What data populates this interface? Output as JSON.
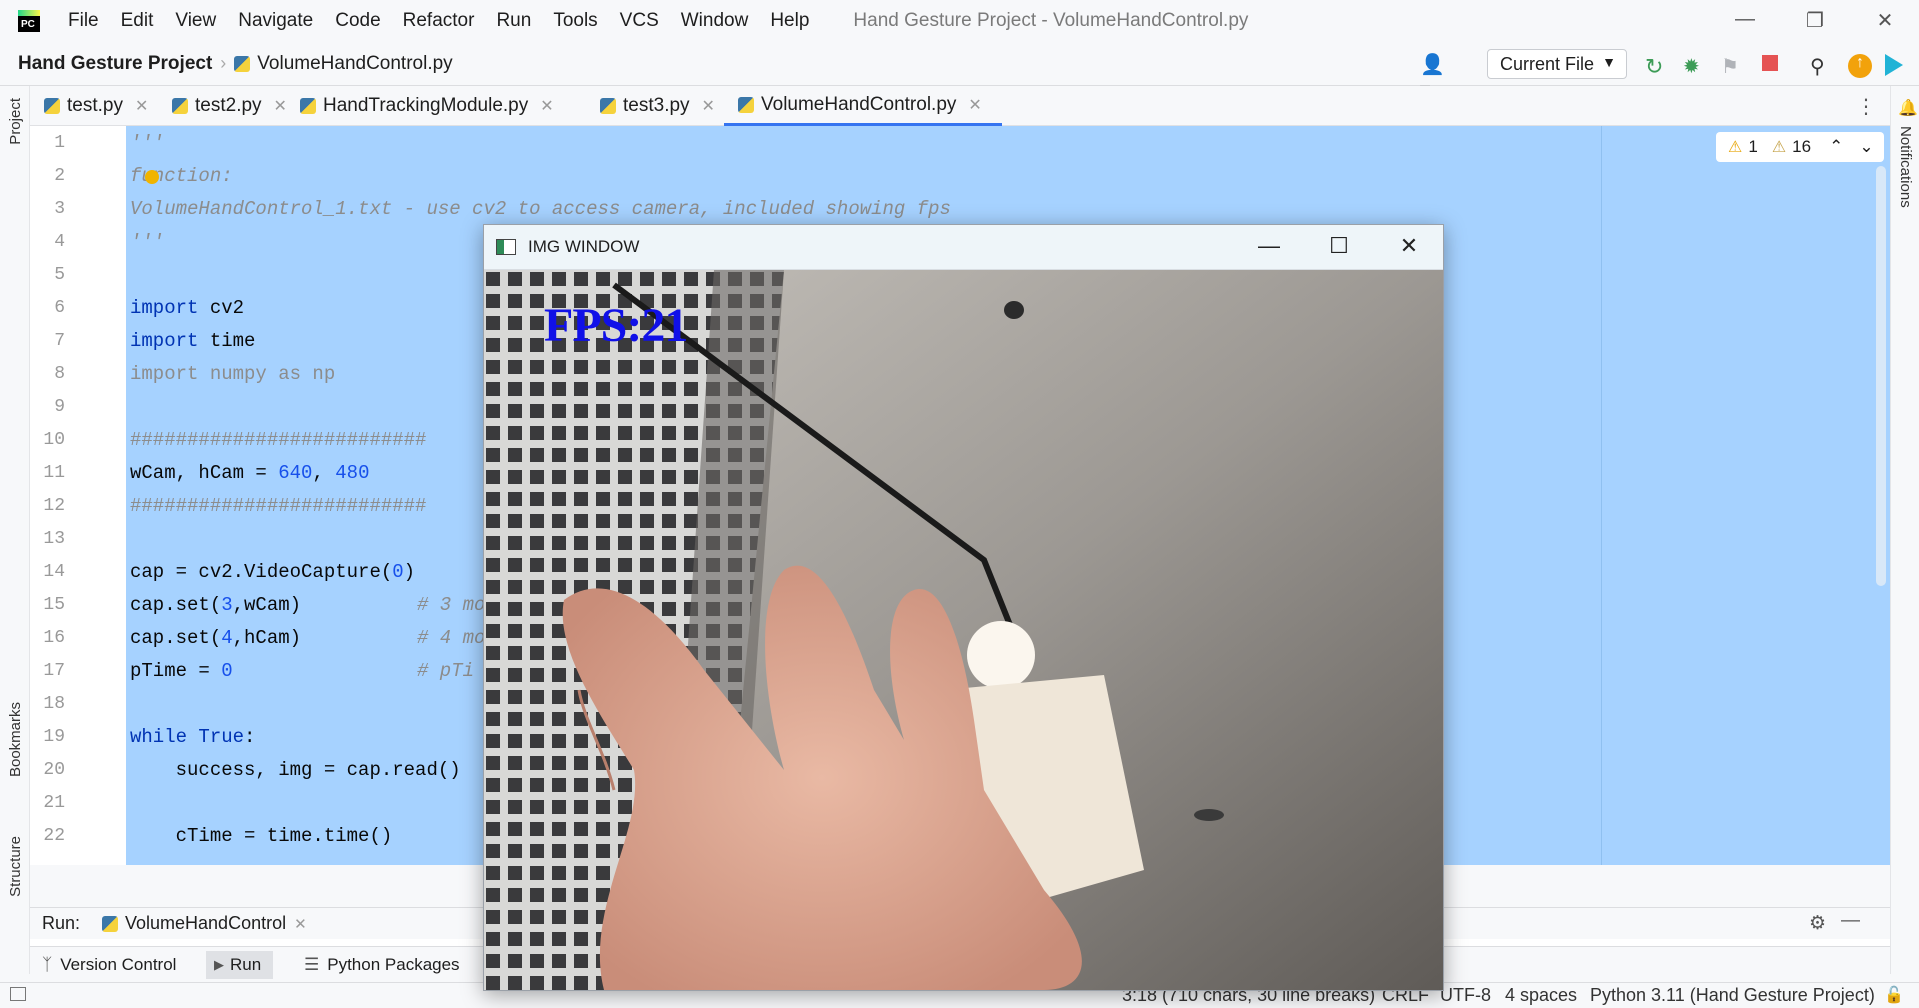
{
  "menubar": {
    "items": [
      "File",
      "Edit",
      "View",
      "Navigate",
      "Code",
      "Refactor",
      "Run",
      "Tools",
      "VCS",
      "Window",
      "Help"
    ],
    "window_title": "Hand Gesture Project - VolumeHandControl.py"
  },
  "navbar": {
    "project": "Hand Gesture Project",
    "file": "VolumeHandControl.py",
    "run_config": "Current File"
  },
  "left_stripe": {
    "project": "Project",
    "bookmarks": "Bookmarks",
    "structure": "Structure"
  },
  "right_stripe": {
    "notifications": "Notifications"
  },
  "tabs": [
    {
      "label": "test.py",
      "active": false
    },
    {
      "label": "test2.py",
      "active": false
    },
    {
      "label": "HandTrackingModule.py",
      "active": false
    },
    {
      "label": "test3.py",
      "active": false
    },
    {
      "label": "VolumeHandControl.py",
      "active": true
    }
  ],
  "inspections": {
    "warnings": "1",
    "weak_warnings": "16"
  },
  "editor": {
    "line_numbers": [
      "1",
      "2",
      "3",
      "4",
      "5",
      "6",
      "7",
      "8",
      "9",
      "10",
      "11",
      "12",
      "13",
      "14",
      "15",
      "16",
      "17",
      "18",
      "19",
      "20",
      "21",
      "22"
    ],
    "lines": {
      "l1": "'''",
      "l2": "function:",
      "l3": "VolumeHandControl_1.txt - use cv2 to access camera, included showing fps",
      "l4": "'''",
      "l6_kw": "import",
      "l6_rest": " cv2",
      "l7_kw": "import",
      "l7_rest": " time",
      "l8": "import numpy as np",
      "l10": "##########################",
      "l11_a": "wCam, hCam = ",
      "l11_n1": "640",
      "l11_b": ", ",
      "l11_n2": "480",
      "l12": "##########################",
      "l14_a": "cap = cv2.VideoCapture(",
      "l14_n": "0",
      "l14_b": ")",
      "l15_a": "cap.set(",
      "l15_n": "3",
      "l15_b": ",wCam)",
      "l15_c": "# 3 mo",
      "l16_a": "cap.set(",
      "l16_n": "4",
      "l16_b": ",hCam)",
      "l16_c": "# 4 mo",
      "l17_a": "pTime = ",
      "l17_n": "0",
      "l17_c": "# pTi",
      "l19_kw": "while",
      "l19_sp": " ",
      "l19_kw2": "True",
      "l19_rest": ":",
      "l20": "    success, img = cap.read()",
      "l22": "    cTime = time.time()"
    }
  },
  "run_window": {
    "label": "Run:",
    "tab": "VolumeHandControl"
  },
  "bottom_tools": {
    "vcs": "Version Control",
    "run": "Run",
    "packages": "Python Packages"
  },
  "statusbar": {
    "position": "3:18 (710 chars, 30 line breaks)",
    "line_sep": "CRLF",
    "encoding": "UTF-8",
    "indent": "4 spaces",
    "interpreter": "Python 3.11 (Hand Gesture Project)"
  },
  "img_window": {
    "title": "IMG WINDOW",
    "fps_text": "FPS:21"
  },
  "colors": {
    "selection": "#a6d2ff",
    "keyword": "#0033b3",
    "number": "#1750eb",
    "fps_text": "#1010e8",
    "accent": "#3574f0"
  }
}
